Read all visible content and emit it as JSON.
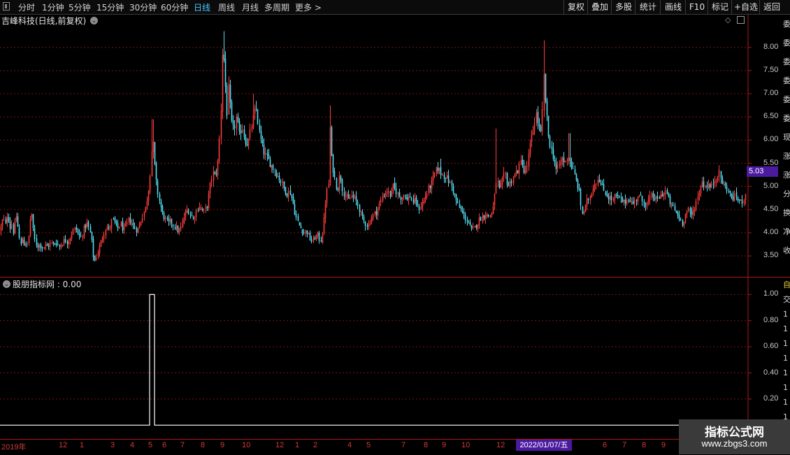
{
  "toolbar": {
    "periods": [
      {
        "label": "分时"
      },
      {
        "label": "1分钟"
      },
      {
        "label": "5分钟"
      },
      {
        "label": "15分钟"
      },
      {
        "label": "30分钟"
      },
      {
        "label": "60分钟"
      },
      {
        "label": "日线",
        "active": true
      },
      {
        "label": "周线"
      },
      {
        "label": "月线"
      },
      {
        "label": "多周期"
      },
      {
        "label": "更多 >"
      }
    ],
    "right_buttons": [
      {
        "label": "复权"
      },
      {
        "label": "叠加"
      },
      {
        "label": "多股"
      },
      {
        "label": "统计"
      },
      {
        "label": "画线"
      },
      {
        "label": "F10"
      },
      {
        "label": "标记"
      },
      {
        "label": "+自选"
      },
      {
        "label": "返回"
      }
    ]
  },
  "chart_title": "吉峰科技(日线,前复权)",
  "current_price": "5.03",
  "indicator": {
    "title": "股朋指标网 : 0.00"
  },
  "side_glyphs": [
    "委",
    "委",
    "委",
    "委",
    "委",
    "委",
    "现",
    "涨",
    "涨",
    "分",
    "换",
    "净",
    "收"
  ],
  "side_glyphs_lower": [
    "自",
    "交",
    "1",
    "1",
    "1",
    "1",
    "1",
    "1",
    "1",
    "1",
    "1"
  ],
  "selected_date": "2022/01/07/五",
  "date_axis": [
    "2019年",
    "12",
    "1",
    "3",
    "4",
    "5",
    "6",
    "7",
    "8",
    "9",
    "10",
    "12",
    "1",
    "2",
    "4",
    "5",
    "7",
    "8",
    "9",
    "10",
    "12",
    "6",
    "7",
    "8",
    "9"
  ],
  "watermark": {
    "title": "指标公式网",
    "url": "www.zbgs3.com"
  },
  "colors": {
    "up": "#ff3c3c",
    "down": "#54e1f5",
    "grid": "#7a1414",
    "axis": "#b01818",
    "accent": "#4b1aa0"
  },
  "chart_data": [
    {
      "type": "candlestick",
      "title": "吉峰科技(日线,前复权)",
      "y_ticks": [
        3.5,
        4.0,
        4.5,
        5.0,
        5.5,
        6.0,
        6.5,
        7.0,
        7.5,
        8.0
      ],
      "ylim": [
        3.05,
        8.45
      ],
      "close_path": [
        [
          0,
          4.05
        ],
        [
          3,
          4.25
        ],
        [
          5,
          4.3
        ],
        [
          8,
          4.15
        ],
        [
          10,
          4.4
        ],
        [
          12,
          4.3
        ],
        [
          14,
          4.1
        ],
        [
          16,
          4.25
        ],
        [
          18,
          4.0
        ],
        [
          20,
          4.1
        ],
        [
          22,
          4.3
        ],
        [
          24,
          4.4
        ],
        [
          26,
          3.95
        ],
        [
          28,
          3.85
        ],
        [
          30,
          3.7
        ],
        [
          32,
          3.9
        ],
        [
          34,
          3.75
        ],
        [
          36,
          3.8
        ],
        [
          38,
          3.7
        ],
        [
          40,
          3.85
        ],
        [
          42,
          4.1
        ],
        [
          44,
          4.6
        ],
        [
          46,
          4.2
        ],
        [
          48,
          3.95
        ],
        [
          50,
          3.8
        ],
        [
          53,
          3.7
        ],
        [
          56,
          3.75
        ],
        [
          60,
          3.68
        ],
        [
          64,
          3.72
        ],
        [
          68,
          3.7
        ],
        [
          72,
          3.78
        ],
        [
          76,
          3.75
        ],
        [
          80,
          3.8
        ],
        [
          84,
          3.7
        ],
        [
          88,
          3.76
        ],
        [
          92,
          3.85
        ],
        [
          96,
          3.8
        ],
        [
          100,
          3.9
        ],
        [
          104,
          4.05
        ],
        [
          108,
          4.1
        ],
        [
          112,
          3.95
        ],
        [
          116,
          3.9
        ],
        [
          120,
          4.1
        ],
        [
          124,
          4.2
        ],
        [
          128,
          4.05
        ],
        [
          132,
          3.7
        ],
        [
          134,
          3.3
        ],
        [
          136,
          3.45
        ],
        [
          140,
          3.6
        ],
        [
          144,
          3.8
        ],
        [
          148,
          4.0
        ],
        [
          152,
          4.15
        ],
        [
          156,
          4.05
        ],
        [
          160,
          4.3
        ],
        [
          164,
          4.2
        ],
        [
          168,
          4.1
        ],
        [
          172,
          4.2
        ],
        [
          176,
          4.05
        ],
        [
          180,
          4.15
        ],
        [
          184,
          4.3
        ],
        [
          188,
          4.2
        ],
        [
          192,
          4.1
        ],
        [
          196,
          4.05
        ],
        [
          200,
          4.2
        ],
        [
          204,
          4.4
        ],
        [
          208,
          4.55
        ],
        [
          212,
          4.9
        ],
        [
          215,
          5.4
        ],
        [
          218,
          6.1
        ],
        [
          220,
          5.6
        ],
        [
          223,
          5.1
        ],
        [
          226,
          4.8
        ],
        [
          229,
          4.6
        ],
        [
          232,
          4.4
        ],
        [
          236,
          4.3
        ],
        [
          240,
          4.2
        ],
        [
          244,
          4.25
        ],
        [
          248,
          4.15
        ],
        [
          252,
          4.1
        ],
        [
          256,
          4.0
        ],
        [
          260,
          4.2
        ],
        [
          264,
          4.4
        ],
        [
          268,
          4.5
        ],
        [
          272,
          4.4
        ],
        [
          276,
          4.3
        ],
        [
          280,
          4.45
        ],
        [
          284,
          4.6
        ],
        [
          288,
          4.5
        ],
        [
          292,
          4.45
        ],
        [
          296,
          4.6
        ],
        [
          300,
          5.0
        ],
        [
          304,
          5.3
        ],
        [
          308,
          5.2
        ],
        [
          312,
          5.6
        ],
        [
          316,
          6.8
        ],
        [
          318,
          8.0
        ],
        [
          321,
          7.6
        ],
        [
          324,
          6.5
        ],
        [
          327,
          7.2
        ],
        [
          330,
          6.4
        ],
        [
          334,
          6.2
        ],
        [
          338,
          6.5
        ],
        [
          342,
          6.1
        ],
        [
          346,
          6.3
        ],
        [
          350,
          6.0
        ],
        [
          354,
          5.9
        ],
        [
          358,
          6.2
        ],
        [
          362,
          6.5
        ],
        [
          366,
          6.7
        ],
        [
          370,
          6.2
        ],
        [
          374,
          5.9
        ],
        [
          378,
          5.7
        ],
        [
          382,
          5.6
        ],
        [
          386,
          5.5
        ],
        [
          390,
          5.4
        ],
        [
          394,
          5.3
        ],
        [
          398,
          5.2
        ],
        [
          402,
          5.1
        ],
        [
          406,
          4.95
        ],
        [
          410,
          4.85
        ],
        [
          414,
          4.9
        ],
        [
          418,
          4.7
        ],
        [
          422,
          4.4
        ],
        [
          426,
          4.2
        ],
        [
          430,
          4.1
        ],
        [
          434,
          4.0
        ],
        [
          438,
          4.05
        ],
        [
          442,
          3.9
        ],
        [
          446,
          3.8
        ],
        [
          450,
          3.9
        ],
        [
          454,
          3.95
        ],
        [
          458,
          3.8
        ],
        [
          462,
          4.1
        ],
        [
          466,
          4.8
        ],
        [
          470,
          5.1
        ],
        [
          472,
          6.4
        ],
        [
          474,
          5.6
        ],
        [
          478,
          5.2
        ],
        [
          482,
          4.9
        ],
        [
          486,
          5.3
        ],
        [
          490,
          4.9
        ],
        [
          494,
          4.8
        ],
        [
          498,
          4.7
        ],
        [
          502,
          4.8
        ],
        [
          506,
          4.75
        ],
        [
          510,
          4.65
        ],
        [
          514,
          4.5
        ],
        [
          518,
          4.3
        ],
        [
          522,
          4.2
        ],
        [
          526,
          4.15
        ],
        [
          530,
          4.3
        ],
        [
          534,
          4.4
        ],
        [
          538,
          4.45
        ],
        [
          542,
          4.6
        ],
        [
          546,
          4.75
        ],
        [
          550,
          4.85
        ],
        [
          554,
          4.9
        ],
        [
          558,
          4.8
        ],
        [
          562,
          5.0
        ],
        [
          566,
          4.9
        ],
        [
          570,
          4.8
        ],
        [
          574,
          4.75
        ],
        [
          578,
          4.85
        ],
        [
          582,
          4.7
        ],
        [
          586,
          4.8
        ],
        [
          590,
          4.65
        ],
        [
          594,
          4.7
        ],
        [
          598,
          4.5
        ],
        [
          602,
          4.6
        ],
        [
          606,
          4.7
        ],
        [
          610,
          4.85
        ],
        [
          614,
          5.0
        ],
        [
          618,
          5.1
        ],
        [
          622,
          5.3
        ],
        [
          626,
          5.4
        ],
        [
          630,
          5.3
        ],
        [
          634,
          5.25
        ],
        [
          638,
          5.2
        ],
        [
          642,
          5.1
        ],
        [
          646,
          5.0
        ],
        [
          650,
          4.8
        ],
        [
          654,
          4.6
        ],
        [
          658,
          4.5
        ],
        [
          662,
          4.4
        ],
        [
          666,
          4.3
        ],
        [
          670,
          4.2
        ],
        [
          674,
          4.05
        ],
        [
          678,
          4.1
        ],
        [
          682,
          4.2
        ],
        [
          686,
          4.3
        ],
        [
          690,
          4.35
        ],
        [
          694,
          4.4
        ],
        [
          698,
          4.35
        ],
        [
          702,
          4.4
        ],
        [
          706,
          4.6
        ],
        [
          710,
          5.2
        ],
        [
          714,
          4.9
        ],
        [
          718,
          5.1
        ],
        [
          722,
          5.3
        ],
        [
          726,
          5.0
        ],
        [
          730,
          5.1
        ],
        [
          734,
          5.2
        ],
        [
          738,
          5.3
        ],
        [
          742,
          5.4
        ],
        [
          746,
          5.6
        ],
        [
          750,
          5.2
        ],
        [
          754,
          5.5
        ],
        [
          758,
          5.9
        ],
        [
          762,
          6.2
        ],
        [
          766,
          6.6
        ],
        [
          770,
          6.3
        ],
        [
          774,
          6.1
        ],
        [
          778,
          7.5
        ],
        [
          780,
          6.8
        ],
        [
          784,
          6.1
        ],
        [
          788,
          5.8
        ],
        [
          792,
          5.6
        ],
        [
          796,
          5.3
        ],
        [
          800,
          5.5
        ],
        [
          804,
          5.6
        ],
        [
          808,
          5.5
        ],
        [
          812,
          5.7
        ],
        [
          816,
          5.5
        ],
        [
          820,
          5.3
        ],
        [
          824,
          5.1
        ],
        [
          828,
          4.9
        ],
        [
          832,
          4.4
        ],
        [
          836,
          4.5
        ],
        [
          840,
          4.7
        ],
        [
          844,
          4.8
        ],
        [
          848,
          5.0
        ],
        [
          852,
          5.1
        ],
        [
          856,
          5.2
        ],
        [
          860,
          5.0
        ],
        [
          864,
          4.9
        ],
        [
          868,
          4.8
        ],
        [
          872,
          4.75
        ],
        [
          876,
          4.7
        ],
        [
          880,
          4.8
        ],
        [
          884,
          4.75
        ],
        [
          888,
          4.7
        ],
        [
          892,
          4.65
        ],
        [
          896,
          4.7
        ],
        [
          900,
          4.75
        ],
        [
          904,
          4.6
        ],
        [
          908,
          4.7
        ],
        [
          912,
          4.8
        ],
        [
          916,
          4.75
        ],
        [
          920,
          4.65
        ],
        [
          924,
          4.6
        ],
        [
          928,
          4.7
        ],
        [
          932,
          4.8
        ],
        [
          936,
          4.75
        ],
        [
          940,
          4.7
        ],
        [
          944,
          4.8
        ],
        [
          948,
          4.85
        ],
        [
          952,
          4.9
        ],
        [
          956,
          4.7
        ],
        [
          960,
          4.6
        ],
        [
          964,
          4.5
        ],
        [
          968,
          4.4
        ],
        [
          972,
          4.3
        ],
        [
          976,
          4.2
        ],
        [
          980,
          4.4
        ],
        [
          984,
          4.5
        ],
        [
          988,
          4.35
        ],
        [
          992,
          4.5
        ],
        [
          996,
          4.7
        ],
        [
          1000,
          4.9
        ],
        [
          1004,
          5.1
        ],
        [
          1008,
          5.0
        ],
        [
          1012,
          5.05
        ],
        [
          1016,
          4.95
        ],
        [
          1020,
          5.1
        ],
        [
          1024,
          5.2
        ],
        [
          1028,
          5.3
        ],
        [
          1032,
          5.1
        ],
        [
          1036,
          5.0
        ],
        [
          1040,
          4.95
        ],
        [
          1044,
          4.8
        ],
        [
          1048,
          4.75
        ],
        [
          1052,
          4.8
        ],
        [
          1056,
          4.7
        ],
        [
          1060,
          4.65
        ],
        [
          1064,
          4.75
        ],
        [
          1068,
          5.03
        ]
      ],
      "spikes": [
        [
          218,
          6.45
        ],
        [
          320,
          8.35
        ],
        [
          472,
          6.75
        ],
        [
          710,
          6.25
        ],
        [
          778,
          8.15
        ],
        [
          362,
          7.0
        ],
        [
          814,
          6.15
        ],
        [
          630,
          5.6
        ]
      ]
    },
    {
      "type": "line",
      "title": "股朋指标网 : 0.00",
      "y_ticks": [
        0.2,
        0.4,
        0.6,
        0.8,
        1.0
      ],
      "ylim": [
        -0.1,
        1.05
      ],
      "points": [
        [
          0,
          0
        ],
        [
          214,
          0
        ],
        [
          214,
          1
        ],
        [
          221,
          1
        ],
        [
          221,
          0
        ],
        [
          1068,
          0
        ]
      ]
    }
  ]
}
